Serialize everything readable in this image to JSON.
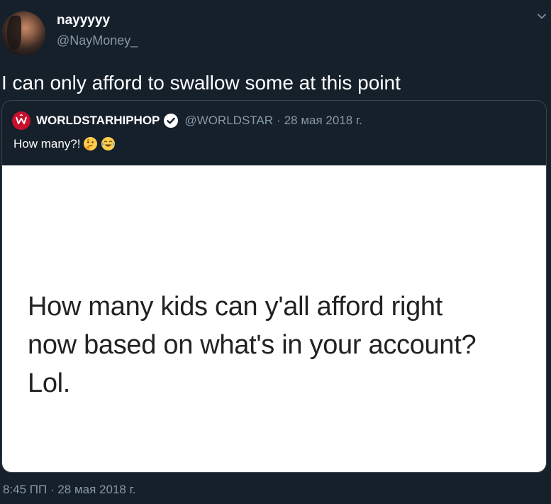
{
  "tweet": {
    "display_name": "nayyyyy",
    "handle": "@NayMoney_",
    "text": "I can only afford to swallow some at this point",
    "timestamp": "8:45 ПП · 28 мая 2018 г.",
    "menu_icon": "chevron-down-icon",
    "avatar_icon": "profile-photo"
  },
  "quoted_tweet": {
    "display_name": "WORLDSTARHIPHOP",
    "handle": "@WORLDSTAR",
    "separator": "·",
    "date": "28 мая 2018 г.",
    "text": "How many?!",
    "emojis": [
      "thinking-face-emoji",
      "tears-of-joy-emoji"
    ],
    "logo_icon": "worldstar-logo-icon",
    "verified_icon": "verified-badge-icon",
    "image_text_lines": [
      "How many kids can y'all afford right",
      "now based on what's in your account?",
      "Lol."
    ]
  },
  "colors": {
    "background": "#15202b",
    "secondary_text": "#8899a6",
    "border": "#38444d",
    "brand_red": "#c8102e"
  }
}
